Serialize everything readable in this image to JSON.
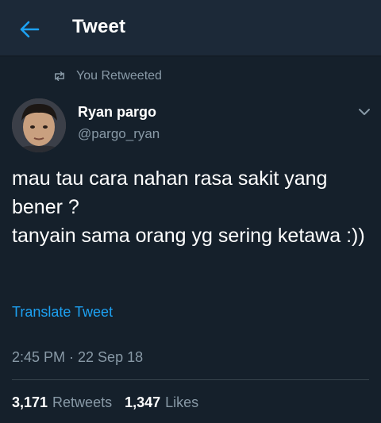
{
  "header": {
    "title": "Tweet",
    "back_icon": "back-arrow-icon",
    "accent": "#1da1f2"
  },
  "retweet_note": {
    "icon": "retweet-icon",
    "text": "You Retweeted"
  },
  "author": {
    "name": "Ryan pargo",
    "handle": "@pargo_ryan",
    "avatar_icon": "avatar-photo"
  },
  "menu_icon": "chevron-down-icon",
  "tweet": {
    "text": "mau tau cara nahan rasa sakit yang bener ?\ntanyain sama orang yg sering ketawa :))",
    "translate_label": "Translate Tweet",
    "timestamp": "2:45 PM · 22 Sep 18"
  },
  "stats": {
    "retweets_count": "3,171",
    "retweets_label": "Retweets",
    "likes_count": "1,347",
    "likes_label": "Likes"
  },
  "colors": {
    "background": "#15202b",
    "header_bg": "#1c2938",
    "secondary_text": "#8899a6",
    "link": "#1da1f2"
  }
}
